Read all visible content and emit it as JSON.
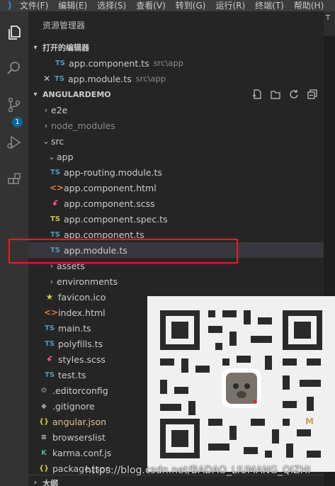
{
  "menubar": {
    "items": [
      "文件(F)",
      "编辑(E)",
      "选择(S)",
      "查看(V)",
      "转到(G)",
      "运行(R)",
      "终端(T)",
      "帮助(H)"
    ]
  },
  "activity": {
    "scm_badge": "1"
  },
  "sidebar": {
    "title": "资源管理器",
    "open_editors": {
      "header": "打开的编辑器",
      "items": [
        {
          "name": "app.component.ts",
          "path": "src\\app"
        },
        {
          "name": "app.module.ts",
          "path": "src\\app"
        }
      ]
    },
    "project": {
      "header": "ANGULARDEMO",
      "tree": {
        "e2e": "e2e",
        "node_modules": "node_modules",
        "src": "src",
        "app": "app",
        "app_routing": "app-routing.module.ts",
        "app_html": "app.component.html",
        "app_scss": "app.component.scss",
        "app_spec": "app.component.spec.ts",
        "app_ts": "app.component.ts",
        "app_module": "app.module.ts",
        "assets": "assets",
        "environments": "environments",
        "favicon": "favicon.ico",
        "index": "index.html",
        "main": "main.ts",
        "polyfills": "polyfills.ts",
        "styles": "styles.scss",
        "test": "test.ts",
        "editorconfig": ".editorconfig",
        "gitignore": ".gitignore",
        "angular_json": "angular.json",
        "browserslist": "browserslist",
        "karma": "karma.conf.js",
        "package_json": "package.json"
      }
    },
    "outline_header": "大纲"
  },
  "icons": {
    "ts": "TS",
    "html": "<>",
    "json": "{}"
  },
  "overlay": {
    "qr_letter": "M",
    "watermark": "https://blog.csdn.net/BADAO_LIUMANG_QIZHI"
  },
  "colors": {
    "highlight": "#e01e1e",
    "ts": "#519aba",
    "badge": "#0e639c"
  }
}
